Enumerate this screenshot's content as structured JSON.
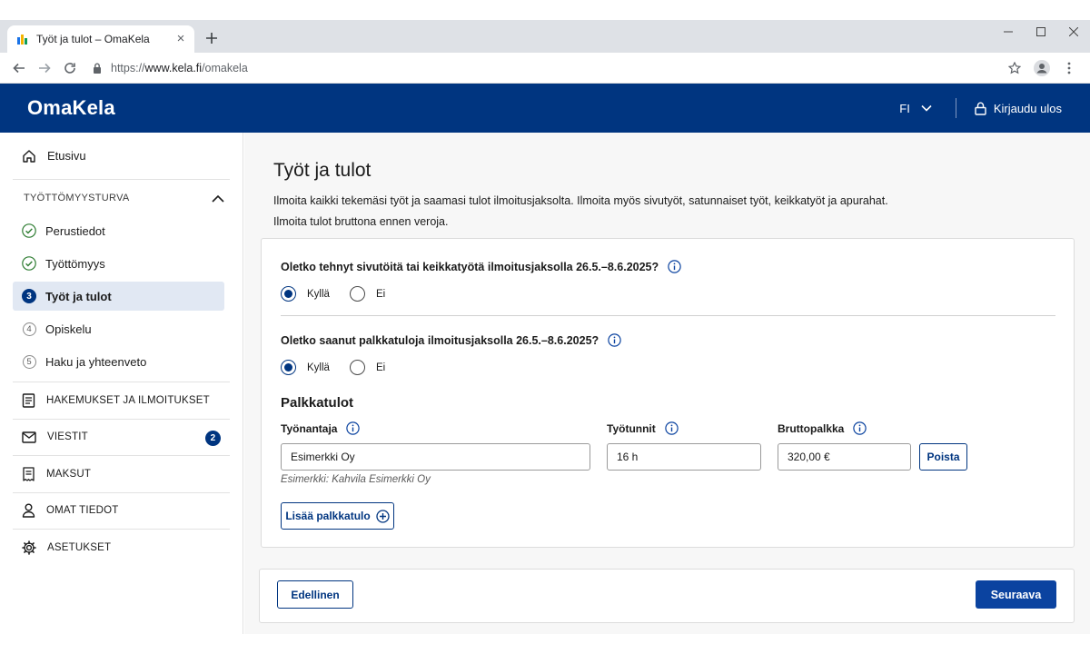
{
  "browser": {
    "tab_title": "Työt ja tulot – OmaKela",
    "tab_close": "×",
    "url_scheme": "https://",
    "url_domain": "www.kela.fi",
    "url_path": "/omakela"
  },
  "header": {
    "brand": "OmaKela",
    "language": "FI",
    "logout_label": "Kirjaudu ulos",
    "color": "#003580"
  },
  "sidebar": {
    "home_label": "Etusivu",
    "section_label": "TYÖTTÖMYYSTURVA",
    "steps": [
      {
        "marker": "done",
        "label": "Perustiedot"
      },
      {
        "marker": "done",
        "label": "Työttömyys"
      },
      {
        "marker": "3",
        "label": "Työt ja tulot",
        "active": true
      },
      {
        "marker": "4",
        "label": "Opiskelu"
      },
      {
        "marker": "5",
        "label": "Haku ja yhteenveto"
      }
    ],
    "links": [
      {
        "icon": "document-list-icon",
        "label": "HAKEMUKSET JA ILMOITUKSET"
      },
      {
        "icon": "envelope-icon",
        "label": "VIESTIT",
        "badge": "2"
      },
      {
        "icon": "receipt-icon",
        "label": "MAKSUT"
      },
      {
        "icon": "person-icon",
        "label": "OMAT TIEDOT"
      },
      {
        "icon": "gear-icon",
        "label": "ASETUKSET"
      }
    ]
  },
  "main": {
    "title": "Työt ja tulot",
    "intro_line1": "Ilmoita kaikki tekemäsi työt ja saamasi tulot ilmoitusjaksolta. Ilmoita myös sivutyöt, satunnaiset työt, keikkatyöt ja apurahat.",
    "intro_line2": "Ilmoita tulot bruttona ennen veroja.",
    "question1": {
      "text": "Oletko tehnyt sivutöitä tai keikkatyötä ilmoitusjaksolla 26.5.–8.6.2025?",
      "yes": "Kyllä",
      "no": "Ei",
      "selected": "yes"
    },
    "question2": {
      "text": "Oletko saanut palkkatuloja ilmoitusjaksolla 26.5.–8.6.2025?",
      "yes": "Kyllä",
      "no": "Ei",
      "selected": "yes"
    },
    "salary": {
      "section_title": "Palkkatulot",
      "employer_label": "Työnantaja",
      "employer_value": "Esimerkki Oy",
      "employer_hint": "Esimerkki: Kahvila Esimerkki Oy",
      "hours_label": "Työtunnit",
      "hours_value": "16 h",
      "gross_label": "Bruttopalkka",
      "gross_value": "320,00 €",
      "remove_label": "Poista",
      "add_label": "Lisää palkkatulo"
    },
    "nav": {
      "previous": "Edellinen",
      "next": "Seuraava"
    }
  }
}
